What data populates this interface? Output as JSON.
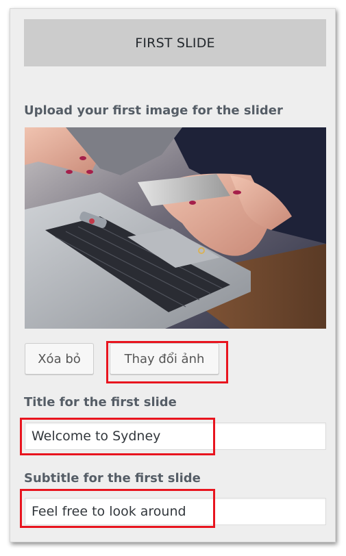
{
  "section": {
    "title": "FIRST SLIDE"
  },
  "image_field": {
    "label": "Upload your first image for the slider",
    "remove_button": "Xóa bỏ",
    "change_button": "Thay đổi ảnh"
  },
  "title_field": {
    "label": "Title for the first slide",
    "value": "Welcome to Sydney"
  },
  "subtitle_field": {
    "label": "Subtitle for the first slide",
    "value": "Feel free to look around"
  },
  "colors": {
    "panel_background": "#eeeeee",
    "header_background": "#cccccc",
    "highlight": "#e8141e"
  }
}
